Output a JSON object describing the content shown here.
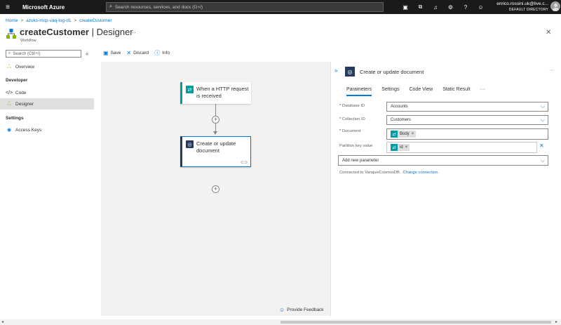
{
  "topbar": {
    "brand": "Microsoft Azure",
    "search_placeholder": "Search resources, services, and docs (G+/)",
    "account_email": "enrico.rossini.uk@live.c...",
    "account_directory": "DEFAULT DIRECTORY"
  },
  "breadcrumb": [
    "Home",
    "azuks-mcp-vaq-log-d1",
    "createCustomer"
  ],
  "page": {
    "title_main": "createCustomer",
    "title_sep": " | ",
    "title_sub": "Designer",
    "subtitle": "Workflow",
    "more": "···"
  },
  "sidebar": {
    "search_placeholder": "Search (Ctrl+/)",
    "collapse": "«",
    "overview": "Overview",
    "developer_heading": "Developer",
    "code": "Code",
    "designer": "Designer",
    "settings_heading": "Settings",
    "access_keys": "Access Keys"
  },
  "toolbar": {
    "save": "Save",
    "discard": "Discard",
    "info": "Info"
  },
  "canvas": {
    "trigger_title_1": "When a HTTP request",
    "trigger_title_2": "is received",
    "action_title_1": "Create or update",
    "action_title_2": "document",
    "feedback": "Provide Feedback"
  },
  "panel": {
    "title": "Create or update document",
    "tabs": [
      "Parameters",
      "Settings",
      "Code View",
      "Static Result",
      "···"
    ],
    "fields": {
      "database_label": "Database ID",
      "database_value": "Accounts",
      "collection_label": "Collection ID",
      "collection_value": "Customers",
      "document_label": "Document",
      "document_token": "Body",
      "partition_label": "Partition key value",
      "partition_token": "id"
    },
    "add_parameter": "Add new parameter",
    "connected_text": "Connected to VanquisCosmosDB.",
    "change_connection": "Change connection."
  },
  "colors": {
    "accent": "#0078d4",
    "topbar": "#1b1a19",
    "http_trigger": "#009da5",
    "cosmos_action": "#243a5e"
  }
}
